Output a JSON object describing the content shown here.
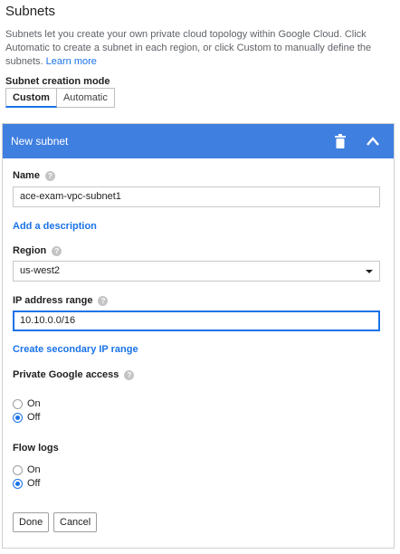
{
  "page": {
    "title": "Subnets",
    "description": "Subnets let you create your own private cloud topology within Google Cloud. Click Automatic to create a subnet in each region, or click Custom to manually define the subnets.",
    "learn_more": "Learn more"
  },
  "subnet_mode": {
    "label": "Subnet creation mode",
    "options": [
      "Custom",
      "Automatic"
    ],
    "selected": "Custom"
  },
  "subnet_panel": {
    "header": "New subnet",
    "name": {
      "label": "Name",
      "value": "ace-exam-vpc-subnet1"
    },
    "add_description": "Add a description",
    "region": {
      "label": "Region",
      "value": "us-west2"
    },
    "ip_range": {
      "label": "IP address range",
      "value": "10.10.0.0/16"
    },
    "secondary_ip": "Create secondary IP range",
    "private_google_access": {
      "label": "Private Google access",
      "options": [
        "On",
        "Off"
      ],
      "selected": "Off"
    },
    "flow_logs": {
      "label": "Flow logs",
      "options": [
        "On",
        "Off"
      ],
      "selected": "Off"
    },
    "done": "Done",
    "cancel": "Cancel"
  },
  "colors": {
    "header_bg": "#3f7fe0",
    "accent": "#1a73e8"
  },
  "icons": {
    "help": "help-icon",
    "delete": "trash-icon",
    "collapse": "chevron-up-icon",
    "dropdown": "caret-down-icon"
  }
}
